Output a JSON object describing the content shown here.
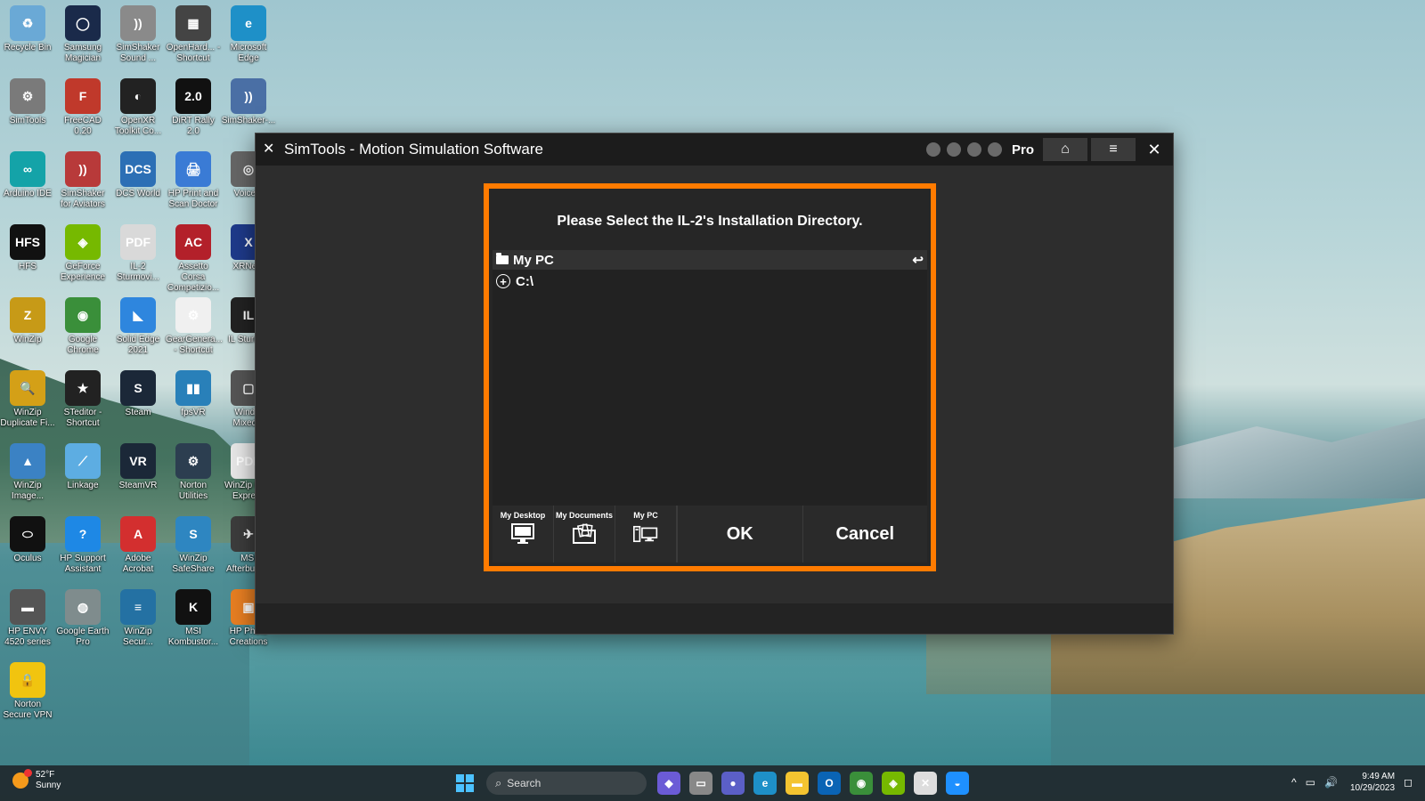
{
  "desktop_icons": [
    {
      "label": "Recycle Bin",
      "icon": "recycle-bin-icon",
      "color": "#6aa9d6",
      "glyph": "♻"
    },
    {
      "label": "Samsung Magician",
      "icon": "samsung-magician-icon",
      "color": "#1a2a4a",
      "glyph": "◯"
    },
    {
      "label": "SimShaker Sound ...",
      "icon": "simshaker-sound-icon",
      "color": "#8a8a8a",
      "glyph": "))"
    },
    {
      "label": "OpenHard... - Shortcut",
      "icon": "openhardware-icon",
      "color": "#444444",
      "glyph": "▦"
    },
    {
      "label": "Microsoft Edge",
      "icon": "edge-icon",
      "color": "#1e90c8",
      "glyph": "e"
    },
    {
      "label": "SimTools",
      "icon": "simtools-icon",
      "color": "#7a7a7a",
      "glyph": "⚙"
    },
    {
      "label": "FreeCAD 0.20",
      "icon": "freecad-icon",
      "color": "#c0392b",
      "glyph": "F"
    },
    {
      "label": "OpenXR Toolkit Co...",
      "icon": "openxr-icon",
      "color": "#222222",
      "glyph": "◐"
    },
    {
      "label": "DiRT Rally 2.0",
      "icon": "dirt-rally-icon",
      "color": "#111111",
      "glyph": "2.0"
    },
    {
      "label": "SimShaker-...",
      "icon": "simshaker-icon",
      "color": "#4a6fa5",
      "glyph": "))"
    },
    {
      "label": "Arduino IDE",
      "icon": "arduino-icon",
      "color": "#14a3a8",
      "glyph": "∞"
    },
    {
      "label": "SimShaker for Aviators",
      "icon": "simshaker-aviators-icon",
      "color": "#b83a3a",
      "glyph": "))"
    },
    {
      "label": "DCS World",
      "icon": "dcs-world-icon",
      "color": "#2c6fb5",
      "glyph": "DCS"
    },
    {
      "label": "HP Print and Scan Doctor",
      "icon": "hp-print-scan-icon",
      "color": "#3a7bd5",
      "glyph": "🖨"
    },
    {
      "label": "Voice...",
      "icon": "voice-icon",
      "color": "#666666",
      "glyph": "◎"
    },
    {
      "label": "HFS",
      "icon": "hfs-icon",
      "color": "#111111",
      "glyph": "HFS"
    },
    {
      "label": "GeForce Experience",
      "icon": "geforce-icon",
      "color": "#76b900",
      "glyph": "◈"
    },
    {
      "label": "IL-2 Sturmovi...",
      "icon": "il2-pdf-icon",
      "color": "#d9d9d9",
      "glyph": "PDF"
    },
    {
      "label": "Assetto Corsa Competizio...",
      "icon": "assetto-corsa-icon",
      "color": "#b3202a",
      "glyph": "AC"
    },
    {
      "label": "XRNe...",
      "icon": "xrneck-icon",
      "color": "#1e3a8a",
      "glyph": "X"
    },
    {
      "label": "WinZip",
      "icon": "winzip-icon",
      "color": "#c79a17",
      "glyph": "Z"
    },
    {
      "label": "Google Chrome",
      "icon": "chrome-icon",
      "color": "#3a8f3a",
      "glyph": "◉"
    },
    {
      "label": "Solid Edge 2021",
      "icon": "solid-edge-icon",
      "color": "#2e86de",
      "glyph": "◣"
    },
    {
      "label": "GearGenera... - Shortcut",
      "icon": "geargenerator-icon",
      "color": "#f0f0f0",
      "glyph": "⚙"
    },
    {
      "label": "IL Sturm...",
      "icon": "il2-icon",
      "color": "#222222",
      "glyph": "IL"
    },
    {
      "label": "WinZip Duplicate Fi...",
      "icon": "winzip-duplicate-icon",
      "color": "#d4a017",
      "glyph": "🔍"
    },
    {
      "label": "STeditor - Shortcut",
      "icon": "steditor-icon",
      "color": "#222222",
      "glyph": "★"
    },
    {
      "label": "Steam",
      "icon": "steam-icon",
      "color": "#1b2838",
      "glyph": "S"
    },
    {
      "label": "fpsVR",
      "icon": "fpsvr-icon",
      "color": "#2980b9",
      "glyph": "▮▮"
    },
    {
      "label": "Wind... Mixed...",
      "icon": "mixed-reality-icon",
      "color": "#555555",
      "glyph": "▢"
    },
    {
      "label": "WinZip Image...",
      "icon": "winzip-image-icon",
      "color": "#3b82c4",
      "glyph": "▲"
    },
    {
      "label": "Linkage",
      "icon": "linkage-icon",
      "color": "#5dade2",
      "glyph": "⟋"
    },
    {
      "label": "SteamVR",
      "icon": "steamvr-icon",
      "color": "#1b2838",
      "glyph": "VR"
    },
    {
      "label": "Norton Utilities",
      "icon": "norton-utilities-icon",
      "color": "#2c3e50",
      "glyph": "⚙"
    },
    {
      "label": "WinZip PDF Express",
      "icon": "winzip-pdf-icon",
      "color": "#e6e6e6",
      "glyph": "PDF"
    },
    {
      "label": "Oculus",
      "icon": "oculus-icon",
      "color": "#111111",
      "glyph": "⬭"
    },
    {
      "label": "HP Support Assistant",
      "icon": "hp-support-icon",
      "color": "#1e88e5",
      "glyph": "?"
    },
    {
      "label": "Adobe Acrobat",
      "icon": "acrobat-icon",
      "color": "#d32f2f",
      "glyph": "A"
    },
    {
      "label": "WinZip SafeShare",
      "icon": "winzip-safeshare-icon",
      "color": "#2e86c1",
      "glyph": "S"
    },
    {
      "label": "MSI Afterburner",
      "icon": "msi-afterburner-icon",
      "color": "#3c3c3c",
      "glyph": "✈"
    },
    {
      "label": "HP ENVY 4520 series",
      "icon": "hp-envy-printer-icon",
      "color": "#555555",
      "glyph": "▬"
    },
    {
      "label": "Google Earth Pro",
      "icon": "google-earth-icon",
      "color": "#7f8c8d",
      "glyph": "◍"
    },
    {
      "label": "WinZip Secur...",
      "icon": "winzip-secure-icon",
      "color": "#2471a3",
      "glyph": "≡"
    },
    {
      "label": "MSI Kombustor...",
      "icon": "msi-kombustor-icon",
      "color": "#111111",
      "glyph": "K"
    },
    {
      "label": "HP Photo Creations",
      "icon": "hp-photo-icon",
      "color": "#e67e22",
      "glyph": "▣"
    },
    {
      "label": "Norton Secure VPN",
      "icon": "norton-vpn-icon",
      "color": "#f1c40f",
      "glyph": "🔒"
    }
  ],
  "window": {
    "title": "SimTools - Motion Simulation Software",
    "logo_glyph": "✕",
    "edition": "Pro",
    "home_glyph": "⌂",
    "menu_glyph": "≡",
    "close_glyph": "✕"
  },
  "dialog": {
    "prompt": "Please Select the IL-2's Installation Directory.",
    "tree_root": "My PC",
    "back_glyph": "↩",
    "tree_items": [
      {
        "label": "C:\\",
        "expand_glyph": "+"
      }
    ],
    "quick_links": [
      {
        "label": "My Desktop",
        "icon": "desktop-monitor-icon"
      },
      {
        "label": "My Documents",
        "icon": "documents-folder-icon"
      },
      {
        "label": "My PC",
        "icon": "computer-icon"
      }
    ],
    "ok_label": "OK",
    "cancel_label": "Cancel",
    "accent_color": "#ff7b00"
  },
  "taskbar": {
    "temperature": "52°F",
    "condition": "Sunny",
    "search_placeholder": "Search",
    "search_glyph": "⌕",
    "apps": [
      {
        "icon": "copilot-icon",
        "color": "#6b5bd6",
        "glyph": "◆"
      },
      {
        "icon": "file-explorer-window-icon",
        "color": "#888888",
        "glyph": "▭"
      },
      {
        "icon": "teams-chat-icon",
        "color": "#5b5fc7",
        "glyph": "●"
      },
      {
        "icon": "edge-taskbar-icon",
        "color": "#1e90c8",
        "glyph": "e"
      },
      {
        "icon": "file-explorer-icon",
        "color": "#f4c430",
        "glyph": "▬"
      },
      {
        "icon": "outlook-icon",
        "color": "#0a64b5",
        "glyph": "O"
      },
      {
        "icon": "chrome-taskbar-icon",
        "color": "#3a8f3a",
        "glyph": "◉"
      },
      {
        "icon": "nvidia-icon",
        "color": "#76b900",
        "glyph": "◈"
      },
      {
        "icon": "simtools-taskbar-icon",
        "color": "#dddddd",
        "glyph": "✕"
      },
      {
        "icon": "simshaker-taskbar-icon",
        "color": "#1e90ff",
        "glyph": "◒"
      }
    ],
    "tray": {
      "chevron_glyph": "^",
      "network_glyph": "▭",
      "volume_glyph": "🔊",
      "time": "9:49 AM",
      "date": "10/29/2023",
      "notification_glyph": "◻"
    }
  }
}
